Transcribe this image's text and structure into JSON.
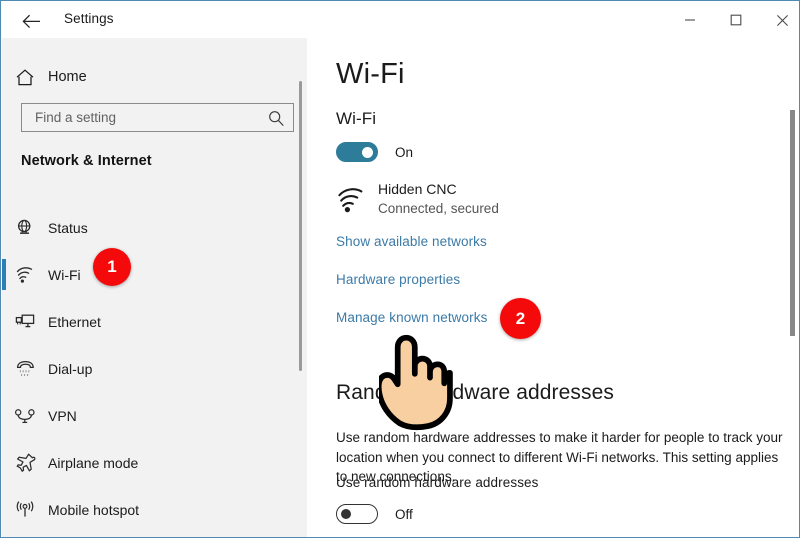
{
  "window": {
    "app_title": "Settings",
    "back_icon": "back-arrow-icon",
    "minimize_label": "─",
    "maximize_label": "□",
    "close_label": "✕",
    "border_color": "#4f8ab5"
  },
  "sidebar": {
    "home": {
      "label": "Home",
      "icon": "home-icon"
    },
    "search": {
      "value": "",
      "placeholder": "Find a setting",
      "icon": "search-icon"
    },
    "section_title": "Network & Internet",
    "selection_color": "#2a7fb5",
    "items": [
      {
        "label": "Status",
        "icon": "globe-status-icon",
        "selected": false
      },
      {
        "label": "Wi-Fi",
        "icon": "wifi-icon",
        "selected": true
      },
      {
        "label": "Ethernet",
        "icon": "ethernet-icon",
        "selected": false
      },
      {
        "label": "Dial-up",
        "icon": "dialup-phone-icon",
        "selected": false
      },
      {
        "label": "VPN",
        "icon": "vpn-icon",
        "selected": false
      },
      {
        "label": "Airplane mode",
        "icon": "airplane-icon",
        "selected": false
      },
      {
        "label": "Mobile hotspot",
        "icon": "mobile-hotspot-icon",
        "selected": false
      }
    ]
  },
  "main": {
    "page_title": "Wi-Fi",
    "wifi_section": {
      "heading": "Wi-Fi",
      "toggle_state": "on",
      "toggle_label": "On",
      "toggle_color": "#2d7d9a"
    },
    "network": {
      "icon": "wifi-connected-icon",
      "name": "Hidden CNC",
      "status": "Connected, secured"
    },
    "links": [
      {
        "label": "Show available networks"
      },
      {
        "label": "Hardware properties"
      },
      {
        "label": "Manage known networks"
      }
    ],
    "link_color": "#3b7aa8",
    "random_hw": {
      "heading": "Random hardware addresses",
      "body": "Use random hardware addresses to make it harder for people to track your location when you connect to different Wi-Fi networks. This setting applies to new connections.",
      "toggle_heading": "Use random hardware addresses",
      "toggle_state": "off",
      "toggle_label": "Off"
    }
  },
  "annotations": {
    "badge_color": "#f40a0a",
    "badges": [
      {
        "number": "1",
        "target": "sidebar-item-wi-fi"
      },
      {
        "number": "2",
        "target": "link-manage-known-networks"
      }
    ],
    "cursor": "pointing-hand-cursor"
  }
}
